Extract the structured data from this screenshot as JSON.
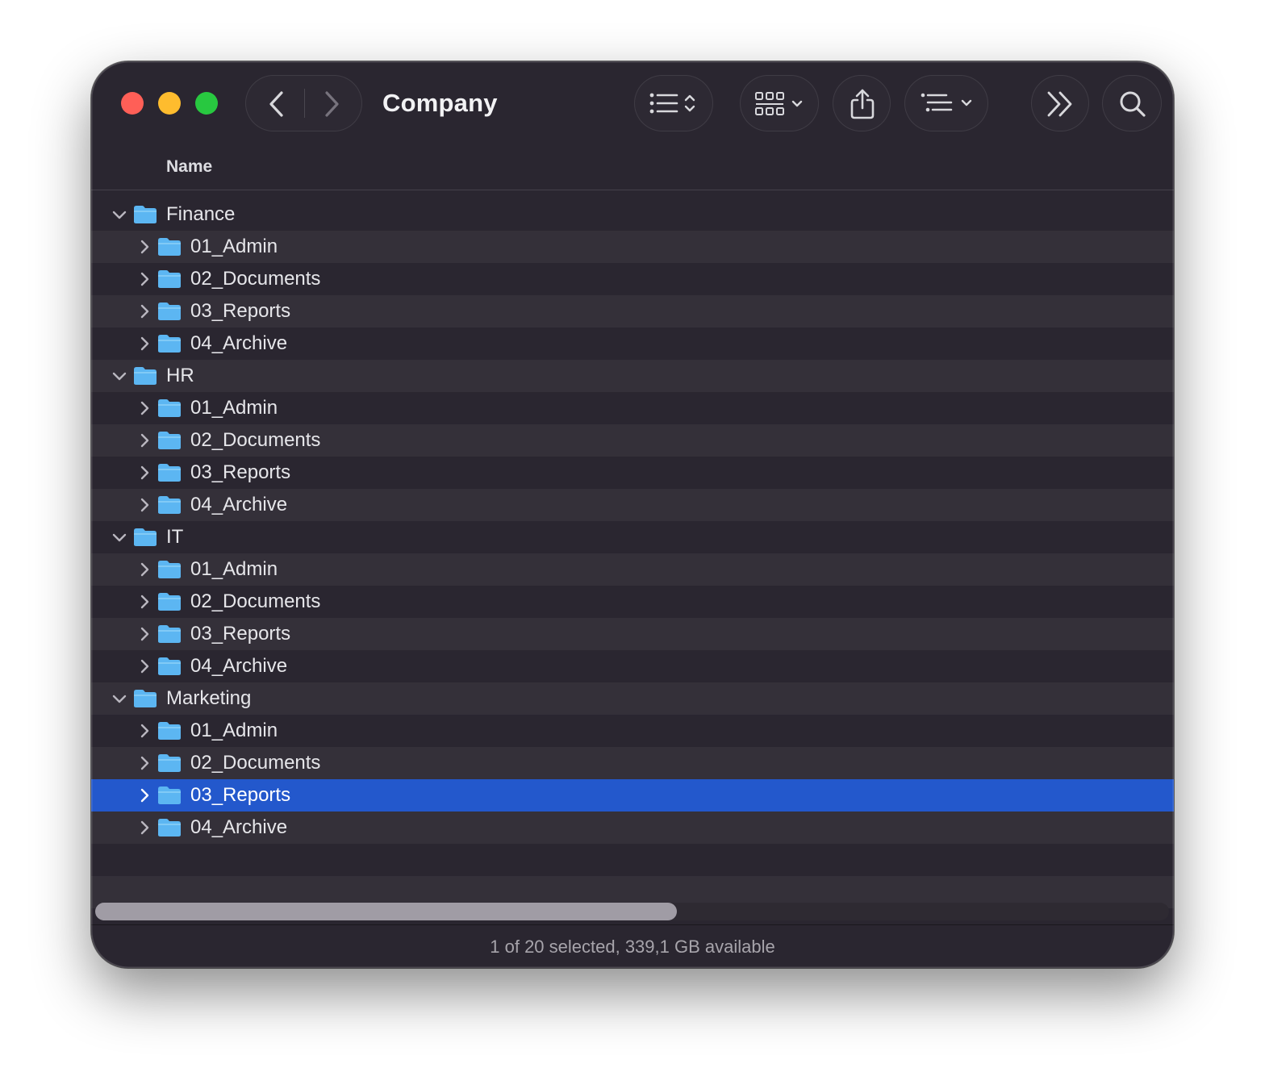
{
  "window": {
    "title": "Company",
    "traffic_lights": {
      "close": "#ff5f57",
      "minimize": "#febc2e",
      "zoom": "#28c840"
    }
  },
  "toolbar": {
    "icons": [
      "chevron-left-icon",
      "chevron-right-icon",
      "list-view-icon",
      "icon-grid-icon",
      "share-icon",
      "group-by-icon",
      "more-chevrons-icon",
      "search-icon"
    ]
  },
  "columns": {
    "name": "Name"
  },
  "tree": [
    {
      "name": "Finance",
      "children": [
        "01_Admin",
        "02_Documents",
        "03_Reports",
        "04_Archive"
      ]
    },
    {
      "name": "HR",
      "children": [
        "01_Admin",
        "02_Documents",
        "03_Reports",
        "04_Archive"
      ]
    },
    {
      "name": "IT",
      "children": [
        "01_Admin",
        "02_Documents",
        "03_Reports",
        "04_Archive"
      ]
    },
    {
      "name": "Marketing",
      "children": [
        "01_Admin",
        "02_Documents",
        "03_Reports",
        "04_Archive"
      ]
    }
  ],
  "selection": {
    "group": 3,
    "child": 2
  },
  "colors": {
    "selection": "#2358cc",
    "folder": "#5cb6f2",
    "background": "#2a2630"
  },
  "status": {
    "text": "1 of 20 selected, 339,1 GB available"
  }
}
